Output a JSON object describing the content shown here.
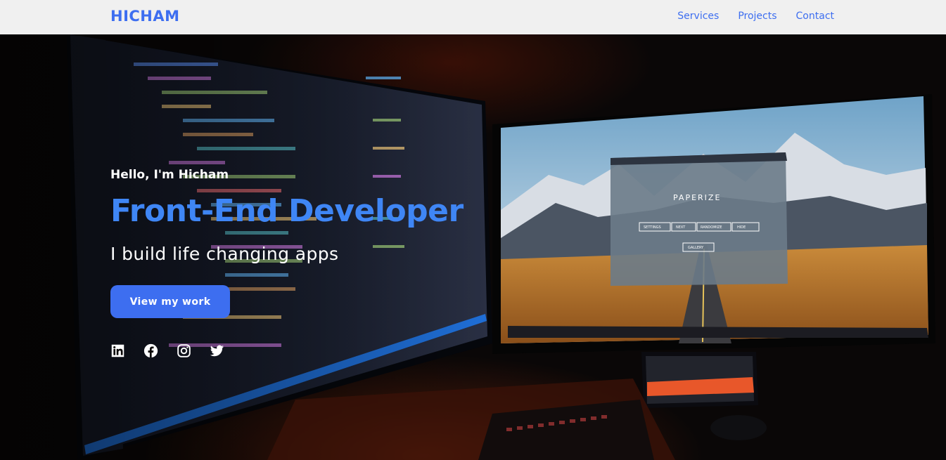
{
  "header": {
    "logo": "HICHAM",
    "nav": [
      {
        "label": "Services"
      },
      {
        "label": "Projects"
      },
      {
        "label": "Contact"
      }
    ]
  },
  "hero": {
    "greeting": "Hello, I'm Hicham",
    "headline": "Front-End Developer",
    "tagline": "I build life changing apps",
    "cta_label": "View my work",
    "socials": [
      {
        "icon": "linkedin-icon"
      },
      {
        "icon": "facebook-icon"
      },
      {
        "icon": "instagram-icon"
      },
      {
        "icon": "twitter-icon"
      }
    ],
    "background": {
      "app_title": "PAPERIZE",
      "app_buttons": [
        "SETTINGS",
        "NEXT",
        "RANDOMIZE",
        "HIDE"
      ],
      "gallery_label": "GALLERY"
    }
  },
  "colors": {
    "accent": "#3d6ef0",
    "headline": "#3f86f5",
    "header_bg": "#f0f0f0",
    "text_light": "#ffffff"
  }
}
